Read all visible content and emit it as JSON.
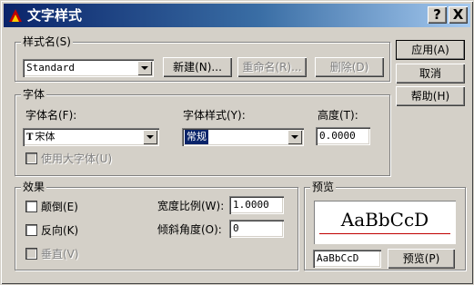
{
  "window": {
    "title": "文字样式",
    "help_glyph": "?",
    "close_glyph": "X",
    "app_icon": "cad-app-icon"
  },
  "style_name_group": {
    "label": "样式名(S)",
    "value": "Standard",
    "new_button": "新建(N)...",
    "rename_button": "重命名(R)...",
    "delete_button": "删除(D)"
  },
  "font_group": {
    "label": "字体",
    "font_name_label": "字体名(F):",
    "font_name_value": "宋体",
    "font_style_label": "字体样式(Y):",
    "font_style_value": "常规",
    "height_label": "高度(T):",
    "height_value": "0.0000",
    "big_font_label": "使用大字体(U)"
  },
  "effects_group": {
    "label": "效果",
    "upside_down_label": "颠倒(E)",
    "backwards_label": "反向(K)",
    "vertical_label": "垂直(V)",
    "width_factor_label": "宽度比例(W):",
    "width_factor_value": "1.0000",
    "oblique_label": "倾斜角度(O):",
    "oblique_value": "0"
  },
  "preview_group": {
    "label": "预览",
    "sample_text": "AaBbCcD",
    "input_value": "AaBbCcD",
    "preview_button": "预览(P)"
  },
  "side_buttons": {
    "apply": "应用(A)",
    "cancel": "取消",
    "help": "帮助(H)"
  },
  "colors": {
    "title_bar_start": "#0a246a",
    "title_bar_end": "#a6caf0",
    "selection": "#0a246a",
    "baseline": "#c00000"
  }
}
